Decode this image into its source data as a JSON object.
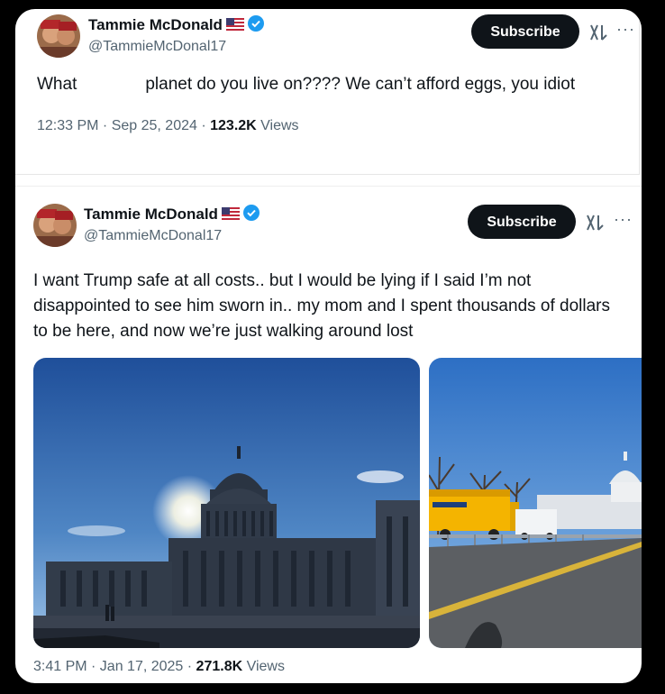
{
  "post1": {
    "name": "Tammie McDonald",
    "handle": "@TammieMcDonal17",
    "subscribe": "Subscribe",
    "more": "···",
    "text_a": "What",
    "text_b": "planet do you live on???? We can’t afford eggs, you idiot",
    "time": "12:33 PM · Sep 25, 2024 · ",
    "views_count": "123.2K",
    "views_label": " Views"
  },
  "post2": {
    "name": "Tammie McDonald",
    "handle": "@TammieMcDonal17",
    "subscribe": "Subscribe",
    "more": "···",
    "text": "I want Trump safe at all costs.. but I would be lying if I said I’m not disappointed to see him sworn in.. my mom and I spent thousands of dollars to be here, and now we’re just walking around lost",
    "time": "3:41 PM · Jan 17, 2025 · ",
    "views_count": "271.8K",
    "views_label": " Views"
  },
  "colors": {
    "accent": "#1d9bf0",
    "text": "#0f1419",
    "muted": "#536471",
    "button": "#0f1419"
  },
  "icons": [
    "verified-badge-icon",
    "us-flag-icon",
    "grok-icon",
    "more-icon"
  ]
}
